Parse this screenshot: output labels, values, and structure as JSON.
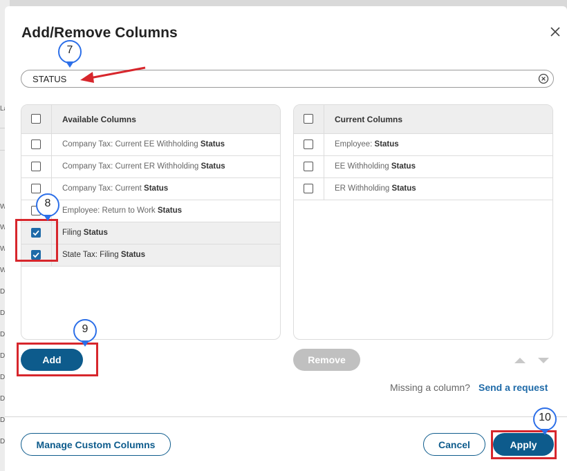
{
  "background": {
    "fragments": [
      "La",
      "W",
      "W",
      "W",
      "W",
      "De",
      "De",
      "De",
      "De",
      "De",
      "De",
      "De",
      "De"
    ]
  },
  "dialog": {
    "title": "Add/Remove Columns",
    "search": {
      "value": "STATUS",
      "placeholder": ""
    }
  },
  "available": {
    "header": "Available Columns",
    "items": [
      {
        "prefix": "Company Tax: Current EE Withholding ",
        "match": "Status",
        "checked": false
      },
      {
        "prefix": "Company Tax: Current ER Withholding ",
        "match": "Status",
        "checked": false
      },
      {
        "prefix": "Company Tax: Current ",
        "match": "Status",
        "checked": false
      },
      {
        "prefix": "Employee: Return to Work ",
        "match": "Status",
        "checked": false
      },
      {
        "prefix": "Filing ",
        "match": "Status",
        "checked": true
      },
      {
        "prefix": "State Tax: Filing ",
        "match": "Status",
        "checked": true
      }
    ]
  },
  "current": {
    "header": "Current Columns",
    "items": [
      {
        "prefix": "Employee: ",
        "match": "Status",
        "checked": false
      },
      {
        "prefix": "EE Withholding ",
        "match": "Status",
        "checked": false
      },
      {
        "prefix": "ER Withholding ",
        "match": "Status",
        "checked": false
      }
    ]
  },
  "buttons": {
    "add": "Add",
    "remove": "Remove",
    "manage": "Manage Custom Columns",
    "cancel": "Cancel",
    "apply": "Apply"
  },
  "missing": {
    "text": "Missing a column?",
    "link": "Send a request"
  },
  "annotations": {
    "step7": "7",
    "step8": "8",
    "step9": "9",
    "step10": "10"
  },
  "colors": {
    "primary": "#0d5b8c",
    "checkbox": "#1e6aa8",
    "annotation_red": "#d7262c",
    "annotation_blue": "#2c6fe8"
  }
}
